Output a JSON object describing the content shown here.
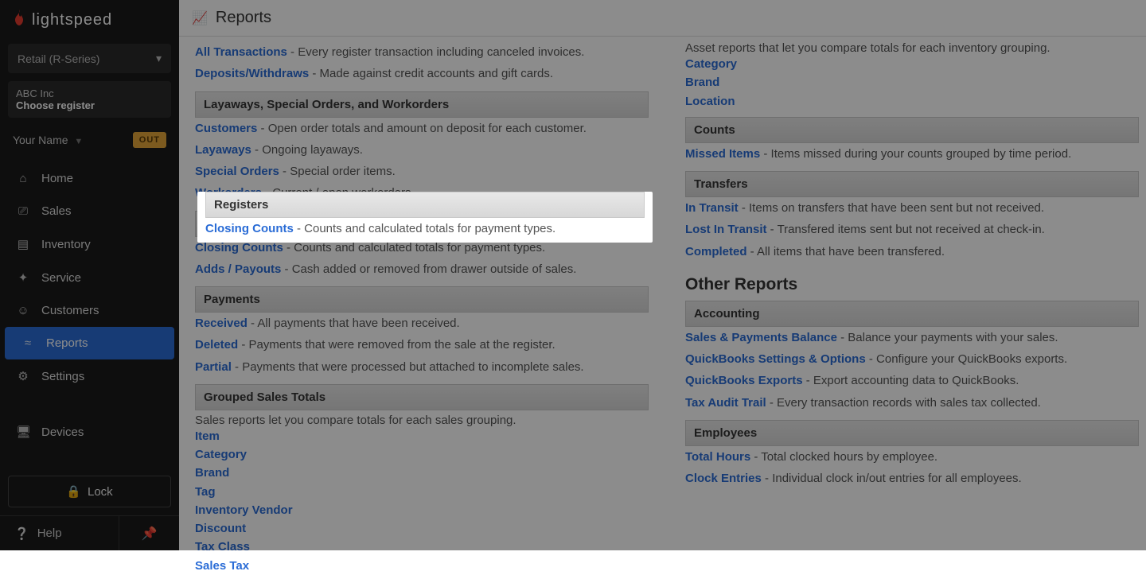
{
  "brand": "lightspeed",
  "product_selector": "Retail (R-Series)",
  "company": {
    "name": "ABC Inc",
    "register_prompt": "Choose register"
  },
  "user": {
    "name": "Your Name",
    "badge": "OUT"
  },
  "nav": [
    {
      "label": "Home",
      "icon": "⌂"
    },
    {
      "label": "Sales",
      "icon": "⎚"
    },
    {
      "label": "Inventory",
      "icon": "▤"
    },
    {
      "label": "Service",
      "icon": "✦"
    },
    {
      "label": "Customers",
      "icon": "☺"
    },
    {
      "label": "Reports",
      "icon": "≈",
      "active": true
    },
    {
      "label": "Settings",
      "icon": "⚙"
    },
    {
      "label": "Devices",
      "icon": "🖥"
    }
  ],
  "lock_label": "Lock",
  "help_label": "Help",
  "page_title": "Reports",
  "left": {
    "top_entries": [
      {
        "link": "All Transactions",
        "desc": " - Every register transaction including canceled invoices."
      },
      {
        "link": "Deposits/Withdraws",
        "desc": " - Made against credit accounts and gift cards."
      }
    ],
    "sections": [
      {
        "title": "Layaways, Special Orders, and Workorders",
        "entries": [
          {
            "link": "Customers",
            "desc": " - Open order totals and amount on deposit for each customer."
          },
          {
            "link": "Layaways",
            "desc": " - Ongoing layaways."
          },
          {
            "link": "Special Orders",
            "desc": " - Special order items."
          },
          {
            "link": "Workorders",
            "desc": " - Current / open workorders."
          }
        ]
      }
    ],
    "highlight": {
      "title": "Registers",
      "entry": {
        "link": "Closing Counts",
        "desc": " - Counts and calculated totals for payment types."
      }
    },
    "after_highlight_entry": {
      "link": "Adds / Payouts",
      "desc": " - Cash added or removed from drawer outside of sales."
    },
    "payments": {
      "title": "Payments",
      "entries": [
        {
          "link": "Received",
          "desc": " - All payments that have been received."
        },
        {
          "link": "Deleted",
          "desc": " - Payments that were removed from the sale at the register."
        },
        {
          "link": "Partial",
          "desc": " - Payments that were processed but attached to incomplete sales."
        }
      ]
    },
    "grouped": {
      "title": "Grouped Sales Totals",
      "intro": "Sales reports let you compare totals for each sales grouping.",
      "links": [
        "Item",
        "Category",
        "Brand",
        "Tag",
        "Inventory Vendor",
        "Discount",
        "Tax Class",
        "Sales Tax"
      ]
    }
  },
  "right": {
    "assets_intro": "Asset reports that let you compare totals for each inventory grouping.",
    "assets_links": [
      "Category",
      "Brand",
      "Location"
    ],
    "counts": {
      "title": "Counts",
      "entries": [
        {
          "link": "Missed Items",
          "desc": " - Items missed during your counts grouped by time period."
        }
      ]
    },
    "transfers": {
      "title": "Transfers",
      "entries": [
        {
          "link": "In Transit",
          "desc": " - Items on transfers that have been sent but not received."
        },
        {
          "link": "Lost In Transit",
          "desc": " - Transfered items sent but not received at check-in."
        },
        {
          "link": "Completed",
          "desc": " - All items that have been transfered."
        }
      ]
    },
    "other_title": "Other Reports",
    "accounting": {
      "title": "Accounting",
      "entries": [
        {
          "link": "Sales & Payments Balance",
          "desc": " - Balance your payments with your sales."
        },
        {
          "link": "QuickBooks Settings & Options",
          "desc": " - Configure your QuickBooks exports."
        },
        {
          "link": "QuickBooks Exports",
          "desc": " - Export accounting data to QuickBooks."
        },
        {
          "link": "Tax Audit Trail",
          "desc": " - Every transaction records with sales tax collected."
        }
      ]
    },
    "employees": {
      "title": "Employees",
      "entries": [
        {
          "link": "Total Hours",
          "desc": " - Total clocked hours by employee."
        },
        {
          "link": "Clock Entries",
          "desc": " - Individual clock in/out entries for all employees."
        }
      ]
    }
  }
}
